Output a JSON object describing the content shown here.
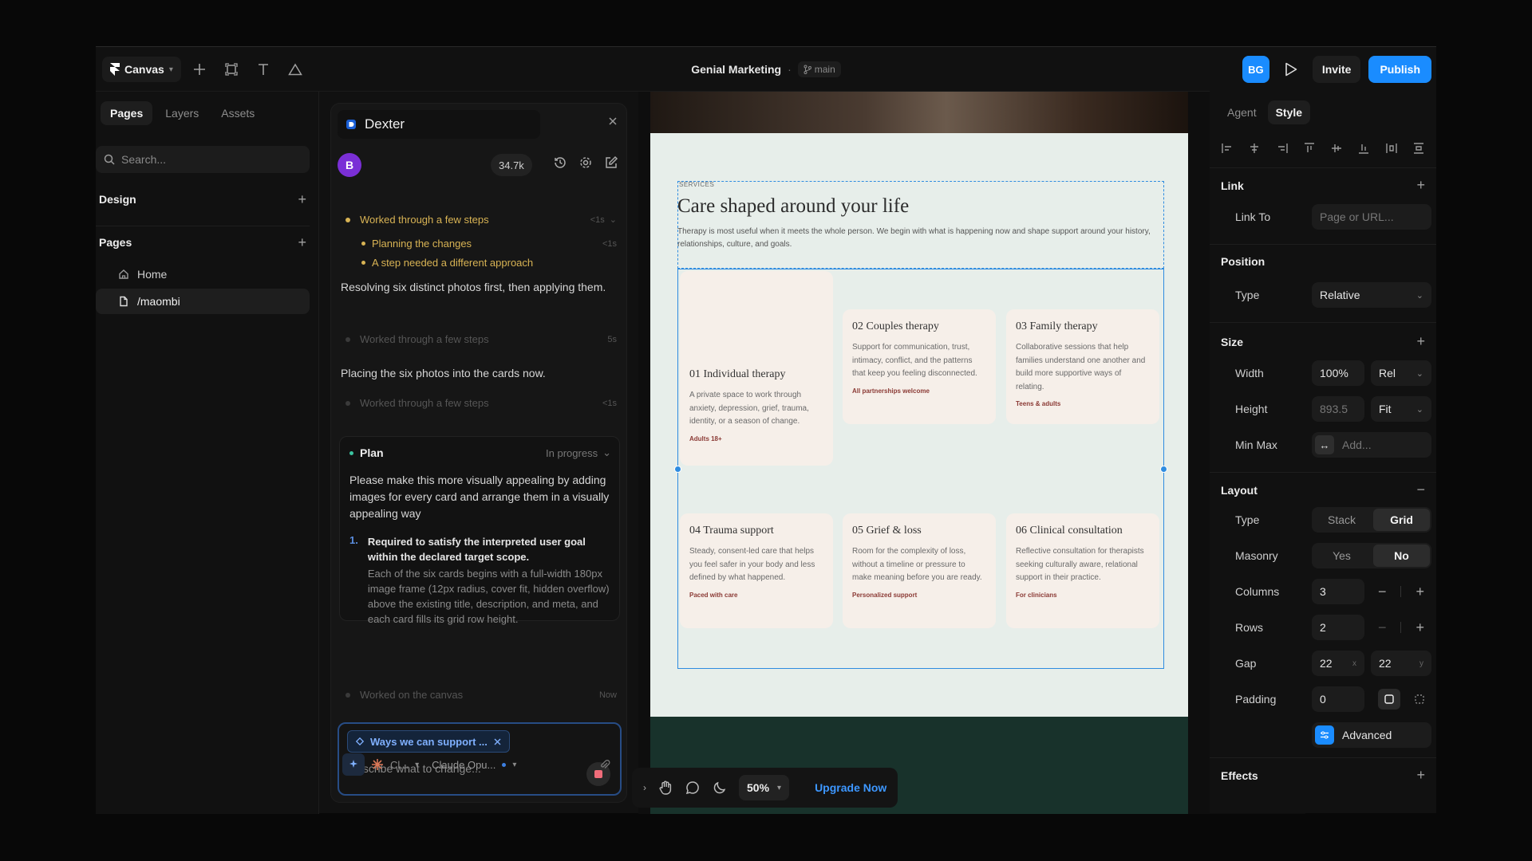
{
  "topbar": {
    "app_menu": "Canvas",
    "project": "Genial Marketing",
    "branch": "main",
    "avatar": "BG",
    "invite": "Invite",
    "publish": "Publish"
  },
  "left": {
    "tabs": [
      "Pages",
      "Layers",
      "Assets"
    ],
    "search_placeholder": "Search...",
    "design": "Design",
    "pages_heading": "Pages",
    "pages": [
      "Home",
      "/maombi"
    ]
  },
  "chat": {
    "title": "Dexter",
    "user_initial": "B",
    "tokens": "34.7k",
    "log1": "Worked through a few steps",
    "log1_time": "<1s",
    "log1a": "Planning the changes",
    "log1a_time": "<1s",
    "log1b": "A step needed a different approach",
    "msg1": "Resolving six distinct photos first, then applying them.",
    "log2": "Worked through a few steps",
    "log2_time": "5s",
    "msg2": "Placing the six photos into the cards now.",
    "log3": "Worked through a few steps",
    "log3_time": "<1s",
    "plan_title": "Plan",
    "plan_status": "In progress",
    "plan_text": "Please make this more visually appealing by adding images for every card and arrange them in a visually appealing way",
    "step_num": "1.",
    "step_title": "Required to satisfy the interpreted user goal within the declared target scope.",
    "step_desc": "Each of the six cards begins with a full-width 180px image frame (12px radius, cover fit, hidden overflow) above the existing title, description, and meta, and each card fills its grid row height.",
    "log4": "Worked on the canvas",
    "log4_time": "Now",
    "context_chip": "Ways we can support ...",
    "input_placeholder": "Describe what to change...",
    "model_short": "Cl...",
    "model": "Claude Opu..."
  },
  "canvas": {
    "services_label": "SERVICES",
    "title": "Care shaped around your life",
    "desc": "Therapy is most useful when it meets the whole person. We begin with what is happening now and shape support around your history, relationships, culture, and goals.",
    "cards": [
      {
        "title": "01 Individual therapy",
        "desc": "A private space to work through anxiety, depression, grief, trauma, identity, or a season of change.",
        "tag": "Adults 18+"
      },
      {
        "title": "02 Couples therapy",
        "desc": "Support for communication, trust, intimacy, conflict, and the patterns that keep you feeling disconnected.",
        "tag": "All partnerships welcome"
      },
      {
        "title": "03 Family therapy",
        "desc": "Collaborative sessions that help families understand one another and build more supportive ways of relating.",
        "tag": "Teens & adults"
      },
      {
        "title": "04 Trauma support",
        "desc": "Steady, consent-led care that helps you feel safer in your body and less defined by what happened.",
        "tag": "Paced with care"
      },
      {
        "title": "05 Grief & loss",
        "desc": "Room for the complexity of loss, without a timeline or pressure to make meaning before you are ready.",
        "tag": "Personalized support"
      },
      {
        "title": "06 Clinical consultation",
        "desc": "Reflective consultation for therapists seeking culturally aware, relational support in their practice.",
        "tag": "For clinicians"
      }
    ],
    "zoom": "50%",
    "upgrade": "Upgrade Now"
  },
  "right": {
    "tabs": [
      "Agent",
      "Style"
    ],
    "link": "Link",
    "link_to": "Link To",
    "link_placeholder": "Page or URL...",
    "position": "Position",
    "type_label": "Type",
    "position_type": "Relative",
    "size": "Size",
    "width_label": "Width",
    "width_value": "100%",
    "width_unit": "Rel",
    "height_label": "Height",
    "height_value": "893.5",
    "height_unit": "Fit",
    "minmax_label": "Min Max",
    "minmax_placeholder": "Add...",
    "layout": "Layout",
    "layout_type_label": "Type",
    "layout_stack": "Stack",
    "layout_grid": "Grid",
    "masonry_label": "Masonry",
    "masonry_yes": "Yes",
    "masonry_no": "No",
    "columns_label": "Columns",
    "columns_value": "3",
    "rows_label": "Rows",
    "rows_value": "2",
    "gap_label": "Gap",
    "gap_x": "22",
    "gap_x_axis": "x",
    "gap_y": "22",
    "gap_y_axis": "y",
    "padding_label": "Padding",
    "padding_value": "0",
    "advanced": "Advanced",
    "effects": "Effects"
  },
  "colors": {
    "accent": "#1a8cff",
    "selection": "#2f8ce0",
    "log_active": "#d8b354",
    "stop": "#f06c7a"
  }
}
